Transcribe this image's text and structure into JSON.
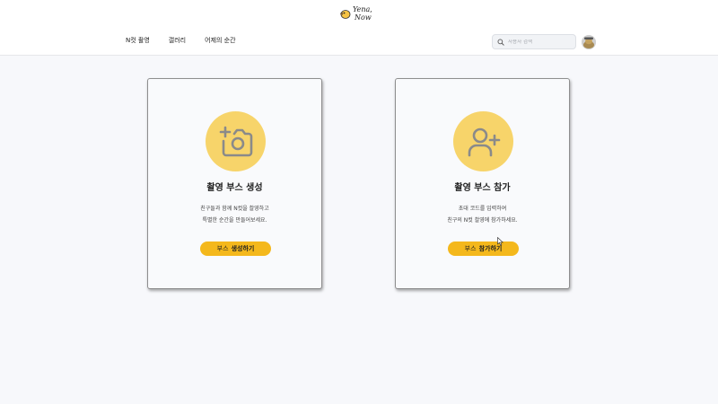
{
  "brand": {
    "line1": "Yena,",
    "line2": "Now"
  },
  "nav": {
    "items": [
      {
        "label": "N컷 촬영"
      },
      {
        "label": "갤러리"
      },
      {
        "label": "어제의 순간"
      }
    ]
  },
  "search": {
    "placeholder": "사용자 검색",
    "icon": "search-icon"
  },
  "avatar": {
    "icon": "avatar-icon"
  },
  "cards": [
    {
      "icon": "camera-plus-icon",
      "title": "촬영 부스 생성",
      "desc_line1": "친구들과 함께 N컷을 촬영하고",
      "desc_line2": "특별한 순간을 만들어보세요.",
      "button_prefix": "부스",
      "button_action": "생성하기"
    },
    {
      "icon": "user-plus-icon",
      "title": "촬영 부스 참가",
      "desc_line1": "초대 코드를 입력하여",
      "desc_line2": "친구의 N컷 촬영에 참가하세요.",
      "button_prefix": "부스",
      "button_action": "참가하기"
    }
  ],
  "colors": {
    "accent": "#f4b81c",
    "icon_circle": "#f7d46a",
    "page_bg": "#f7f8fb",
    "icon_stroke": "#8a8a8a"
  }
}
